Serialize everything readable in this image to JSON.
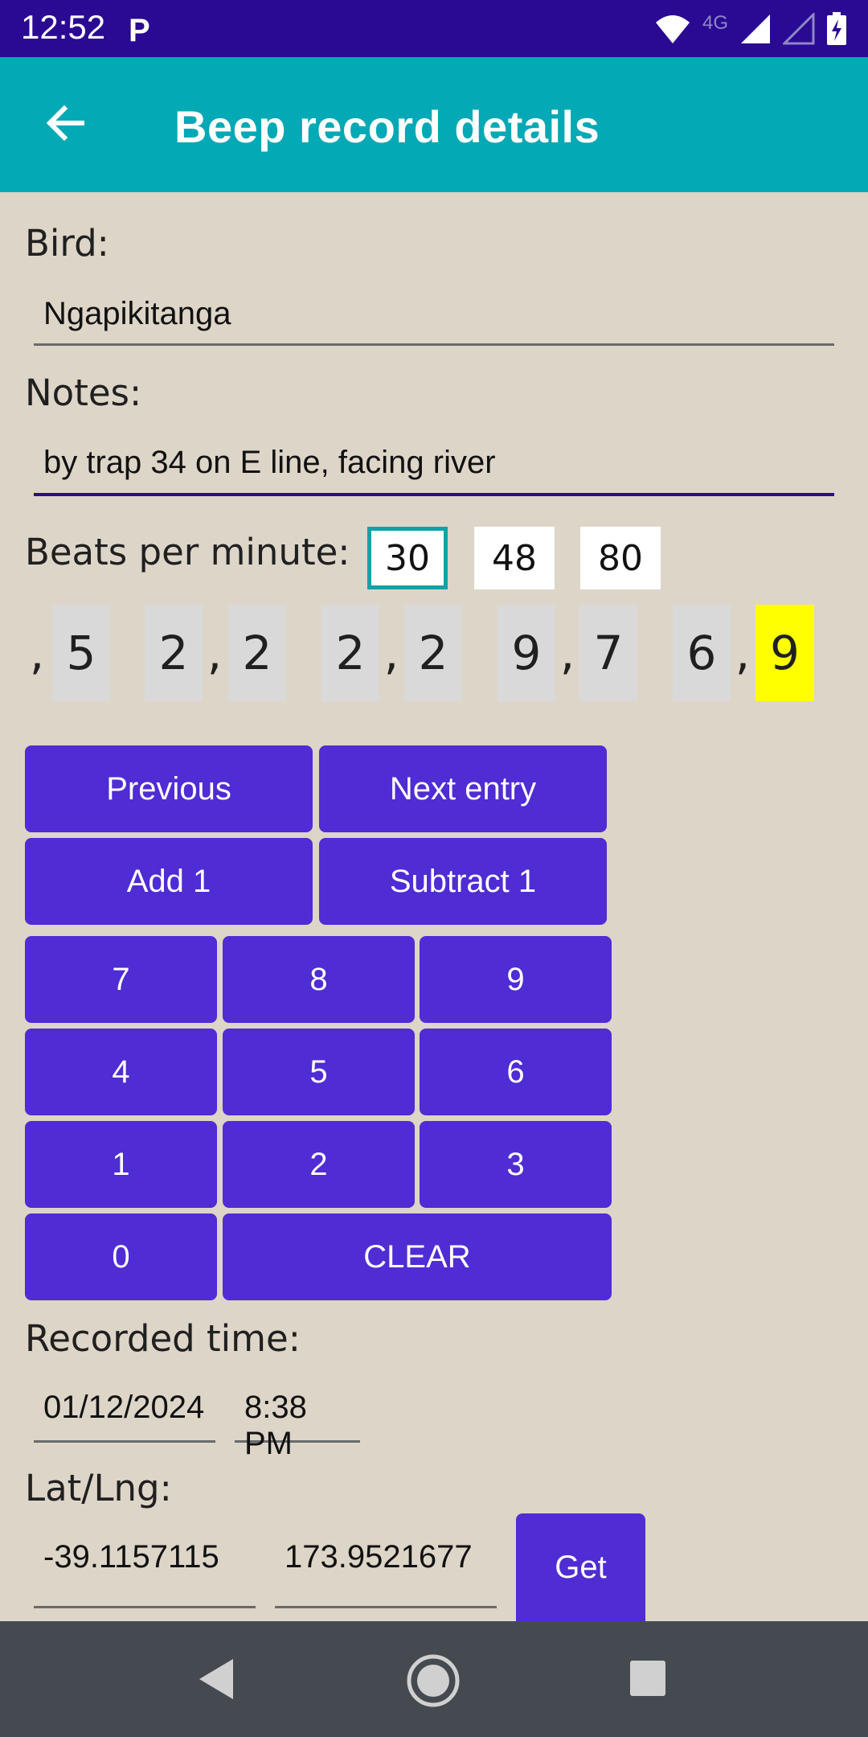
{
  "status_bar": {
    "time": "12:52",
    "app_badge": "P",
    "network": "4G"
  },
  "app_bar": {
    "title": "Beep record details",
    "back_icon": "arrow-left-icon"
  },
  "bird": {
    "label": "Bird:",
    "value": "Ngapikitanga"
  },
  "notes": {
    "label": "Notes:",
    "value": "by trap 34 on E line, facing river"
  },
  "bpm": {
    "label": "Beats per minute:",
    "values": [
      "30",
      "48",
      "80"
    ],
    "selected_index": 0
  },
  "digits": {
    "items": [
      ",",
      "5",
      "2",
      ",",
      "2",
      "2",
      ",",
      "2",
      "9",
      ",",
      "7",
      "6",
      ",",
      "9"
    ],
    "highlighted_index": 13
  },
  "buttons": {
    "previous": "Previous",
    "next_entry": "Next entry",
    "add_1": "Add 1",
    "subtract_1": "Subtract 1",
    "keypad": [
      "7",
      "8",
      "9",
      "4",
      "5",
      "6",
      "1",
      "2",
      "3",
      "0"
    ],
    "clear": "CLEAR",
    "get": "Get"
  },
  "recorded_time": {
    "label": "Recorded time:",
    "date": "01/12/2024",
    "time": "8:38 PM"
  },
  "latlng": {
    "label": "Lat/Lng:",
    "lat": "-39.1157115",
    "lng": "173.9521677"
  },
  "colors": {
    "status_bar": "#2A0A92",
    "app_bar": "#03A9B5",
    "background": "#DDD5C8",
    "button": "#4F2CD4",
    "highlight": "#FFFF00",
    "nav_bar": "#454A50"
  }
}
